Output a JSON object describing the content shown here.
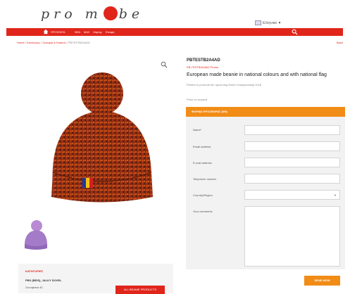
{
  "header": {
    "logo": {
      "left": "pro m",
      "right": "be"
    },
    "language": "Ελληνικά",
    "nav": [
      "ΠΡΟΪΟΝΤΑ",
      "ΝΕΑ",
      "ΜΑΣ",
      "Χάρτης",
      "Επαφή"
    ]
  },
  "breadcrumb": [
    "Home",
    "Κατάλογος",
    "Σκουφιά & Κασκόλ",
    "PBTESTB2A4AD"
  ],
  "back_link": "Back",
  "product": {
    "title": "PBTESTB2A4AD",
    "code": "PB-TESTB2A4AD Promo",
    "description": "European made beanie in national colours and with national flag",
    "subdescription": "Perfect to promote the upcoming World Championship 2018",
    "price_note": "Price on request"
  },
  "form": {
    "header": "ΦΟΡΜΑ ΠΡΟΣΦΟΡΑΣ (EN)",
    "fields": [
      "Name*",
      "Email address",
      "E-mail address",
      "Telephone number",
      "Country/Region",
      "Your comments"
    ],
    "submit": "SEND NOW"
  },
  "category": {
    "title": "ΚΑΤΗΓΟΡΙΕΣ",
    "name": "PBS (BEIS), JALKY DOVEL",
    "sub": "Σκουφάκια 40",
    "button": "ALL BEANIE PRODUCTS"
  },
  "colors": {
    "brand_red": "#e0251b",
    "accent_orange": "#f18c16"
  },
  "icons": [
    "home-icon",
    "search-icon",
    "zoom-icon",
    "chevron-down-icon"
  ]
}
